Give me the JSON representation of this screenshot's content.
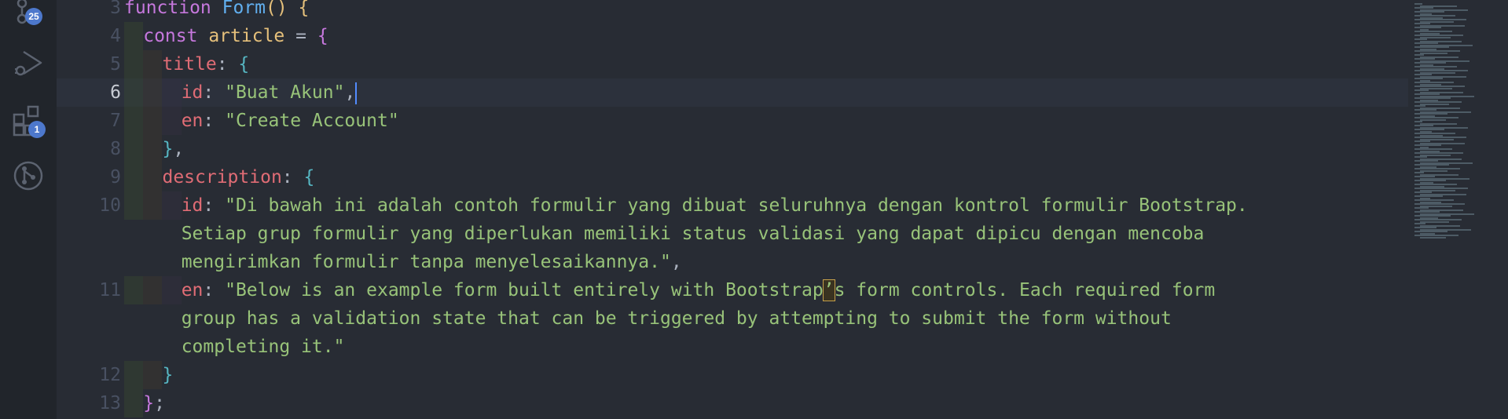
{
  "activity_bar": {
    "source_control_badge": "25",
    "extensions_badge": "1"
  },
  "editor": {
    "lines": [
      {
        "num": "3",
        "parts": [
          [
            "kw",
            "function "
          ],
          [
            "fn",
            "Form"
          ],
          [
            "brace1",
            "() {"
          ]
        ]
      },
      {
        "num": "4",
        "parts": [
          [
            "kw",
            "const "
          ],
          [
            "var",
            "article"
          ],
          [
            "punc",
            " = "
          ],
          [
            "brace3",
            "{"
          ]
        ]
      },
      {
        "num": "5",
        "parts": [
          [
            "prop",
            "title"
          ],
          [
            "punc",
            ": "
          ],
          [
            "brace2",
            "{"
          ]
        ]
      },
      {
        "num": "6",
        "parts": [
          [
            "prop",
            "id"
          ],
          [
            "punc",
            ": "
          ],
          [
            "str",
            "\"Buat Akun\""
          ],
          [
            "punc",
            ","
          ]
        ]
      },
      {
        "num": "7",
        "parts": [
          [
            "prop",
            "en"
          ],
          [
            "punc",
            ": "
          ],
          [
            "str",
            "\"Create Account\""
          ]
        ]
      },
      {
        "num": "8",
        "parts": [
          [
            "brace2",
            "}"
          ],
          [
            "punc",
            ","
          ]
        ]
      },
      {
        "num": "9",
        "parts": [
          [
            "prop",
            "description"
          ],
          [
            "punc",
            ": "
          ],
          [
            "brace2",
            "{"
          ]
        ]
      },
      {
        "num": "10",
        "parts": [
          [
            "prop",
            "id"
          ],
          [
            "punc",
            ": "
          ],
          [
            "str",
            "\"Di bawah ini adalah contoh formulir yang dibuat seluruhnya dengan kontrol formulir Bootstrap."
          ]
        ]
      },
      {
        "num": "",
        "parts": [
          [
            "str",
            "Setiap grup formulir yang diperlukan memiliki status validasi yang dapat dipicu dengan mencoba"
          ]
        ]
      },
      {
        "num": "",
        "parts": [
          [
            "str",
            "mengirimkan formulir tanpa menyelesaikannya.\""
          ],
          [
            "punc",
            ","
          ]
        ]
      },
      {
        "num": "11",
        "parts": [
          [
            "prop",
            "en"
          ],
          [
            "punc",
            ": "
          ],
          [
            "str",
            "\"Below is an example form built entirely with Bootstrap"
          ],
          [
            "quote",
            "’"
          ],
          [
            "str",
            "s form controls. Each required form"
          ]
        ]
      },
      {
        "num": "",
        "parts": [
          [
            "str",
            "group has a validation state that can be triggered by attempting to submit the form without"
          ]
        ]
      },
      {
        "num": "",
        "parts": [
          [
            "str",
            "completing it.\""
          ]
        ]
      },
      {
        "num": "12",
        "parts": [
          [
            "brace2",
            "}"
          ]
        ]
      },
      {
        "num": "13",
        "parts": [
          [
            "brace3",
            "}"
          ],
          [
            "punc",
            ";"
          ]
        ]
      }
    ],
    "current_line": "6"
  }
}
